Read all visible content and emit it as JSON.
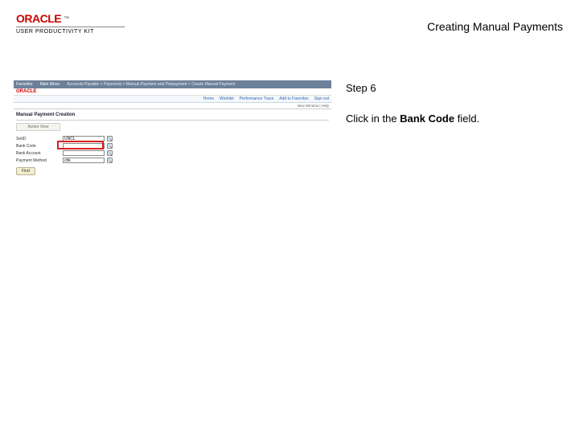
{
  "brand": {
    "name": "ORACLE",
    "tm": "™",
    "sub": "USER PRODUCTIVITY KIT"
  },
  "page_title": "Creating Manual Payments",
  "instruction": {
    "step_label": "Step 6",
    "text_before": "Click in the ",
    "bold_text": "Bank Code",
    "text_after": " field."
  },
  "app": {
    "inner_brand": "ORACLE",
    "tabs": [
      "Favorites",
      "Main Menu"
    ],
    "breadcrumb": "Accounts Payable > Payments > Manual Payment and Prepayment > Create Manual Payment",
    "subnav": [
      "Home",
      "Worklist",
      "Performance Trace",
      "Add to Favorites"
    ],
    "signout": "Sign out",
    "status": "New Window | Help",
    "section_title": "Manual Payment Creation",
    "action_view": "Action View",
    "fields": {
      "setid": {
        "label": "SetID",
        "value": "UNCL"
      },
      "bank_code": {
        "label": "Bank Code",
        "value": ""
      },
      "bank_account": {
        "label": "Bank Account",
        "value": ""
      },
      "payment_method": {
        "label": "Payment Method",
        "value": "chk"
      }
    },
    "find_label": "Find"
  }
}
